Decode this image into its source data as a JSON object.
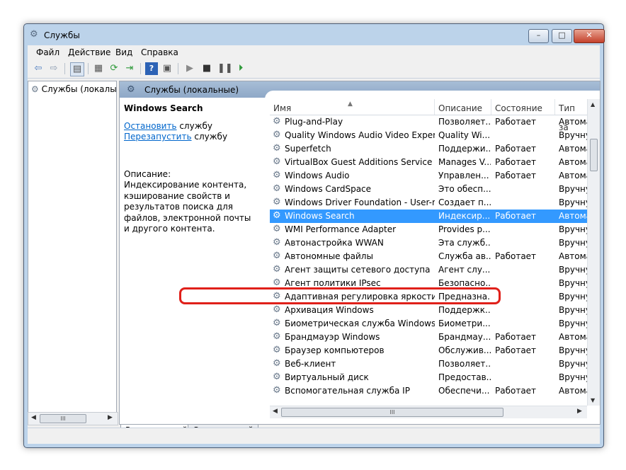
{
  "window": {
    "title": "Службы",
    "controls": {
      "minimize": "–",
      "maximize": "□",
      "close": "✕"
    }
  },
  "menu": [
    "Файл",
    "Действие",
    "Вид",
    "Справка"
  ],
  "toolbar_icons": [
    "back-icon",
    "forward-icon",
    "show-hide-tree-icon",
    "properties-icon",
    "refresh-icon",
    "export-icon",
    "help-icon",
    "view-icon",
    "start-icon",
    "stop-icon",
    "pause-icon",
    "restart-icon"
  ],
  "tree": {
    "root_label": "Службы (локалы"
  },
  "panel": {
    "header": "Службы (локальные)",
    "selected_service": "Windows Search",
    "actions": [
      {
        "link": "Остановить",
        "suffix": " службу"
      },
      {
        "link": "Перезапустить",
        "suffix": " службу"
      }
    ],
    "description_label": "Описание:",
    "description_text": "Индексирование контента, кэширование свойств и результатов поиска для файлов, электронной почты и другого контента."
  },
  "columns": [
    "Имя",
    "Описание",
    "Состояние",
    "Тип за"
  ],
  "services": [
    {
      "name": "Plug-and-Play",
      "desc": "Позволяет...",
      "state": "Работает",
      "start": "Автома"
    },
    {
      "name": "Quality Windows Audio Video Experie...",
      "desc": "Quality Wi...",
      "state": "",
      "start": "Вручну"
    },
    {
      "name": "Superfetch",
      "desc": "Поддержи...",
      "state": "Работает",
      "start": "Автома"
    },
    {
      "name": "VirtualBox Guest Additions Service",
      "desc": "Manages V...",
      "state": "Работает",
      "start": "Автома"
    },
    {
      "name": "Windows Audio",
      "desc": "Управлен...",
      "state": "Работает",
      "start": "Автома"
    },
    {
      "name": "Windows CardSpace",
      "desc": "Это обесп...",
      "state": "",
      "start": "Вручну"
    },
    {
      "name": "Windows Driver Foundation - User-m...",
      "desc": "Создает п...",
      "state": "",
      "start": "Вручну"
    },
    {
      "name": "Windows Search",
      "desc": "Индексир...",
      "state": "Работает",
      "start": "Автома"
    },
    {
      "name": "WMI Performance Adapter",
      "desc": "Provides p...",
      "state": "",
      "start": "Вручну"
    },
    {
      "name": "Автонастройка WWAN",
      "desc": "Эта служб...",
      "state": "",
      "start": "Вручну"
    },
    {
      "name": "Автономные файлы",
      "desc": "Служба ав...",
      "state": "Работает",
      "start": "Автома"
    },
    {
      "name": "Агент защиты сетевого доступа",
      "desc": "Агент слу...",
      "state": "",
      "start": "Вручну"
    },
    {
      "name": "Агент политики IPsec",
      "desc": "Безопасно...",
      "state": "",
      "start": "Вручну"
    },
    {
      "name": "Адаптивная регулировка яркости",
      "desc": "Предназна...",
      "state": "",
      "start": "Вручну"
    },
    {
      "name": "Архивация Windows",
      "desc": "Поддержк...",
      "state": "",
      "start": "Вручну"
    },
    {
      "name": "Биометрическая служба Windows",
      "desc": "Биометри...",
      "state": "",
      "start": "Вручну"
    },
    {
      "name": "Брандмауэр Windows",
      "desc": "Брандмау...",
      "state": "Работает",
      "start": "Автома"
    },
    {
      "name": "Браузер компьютеров",
      "desc": "Обслужив...",
      "state": "Работает",
      "start": "Вручну"
    },
    {
      "name": "Веб-клиент",
      "desc": "Позволяет...",
      "state": "",
      "start": "Вручну"
    },
    {
      "name": "Виртуальный диск",
      "desc": "Предостав...",
      "state": "",
      "start": "Вручну"
    },
    {
      "name": "Вспомогательная служба IP",
      "desc": "Обеспечи...",
      "state": "Работает",
      "start": "Автома"
    }
  ],
  "selected_index": 7,
  "tabs": [
    "Расширенный",
    "Стандартный"
  ],
  "scroll_glyphs": {
    "hthumb": "III",
    "up": "▲",
    "down": "▼",
    "left": "◀",
    "right": "▶",
    "sort": "▲"
  },
  "colors": {
    "selection": "#3399ff",
    "highlight_border": "#e0201a",
    "link": "#0066cc"
  }
}
